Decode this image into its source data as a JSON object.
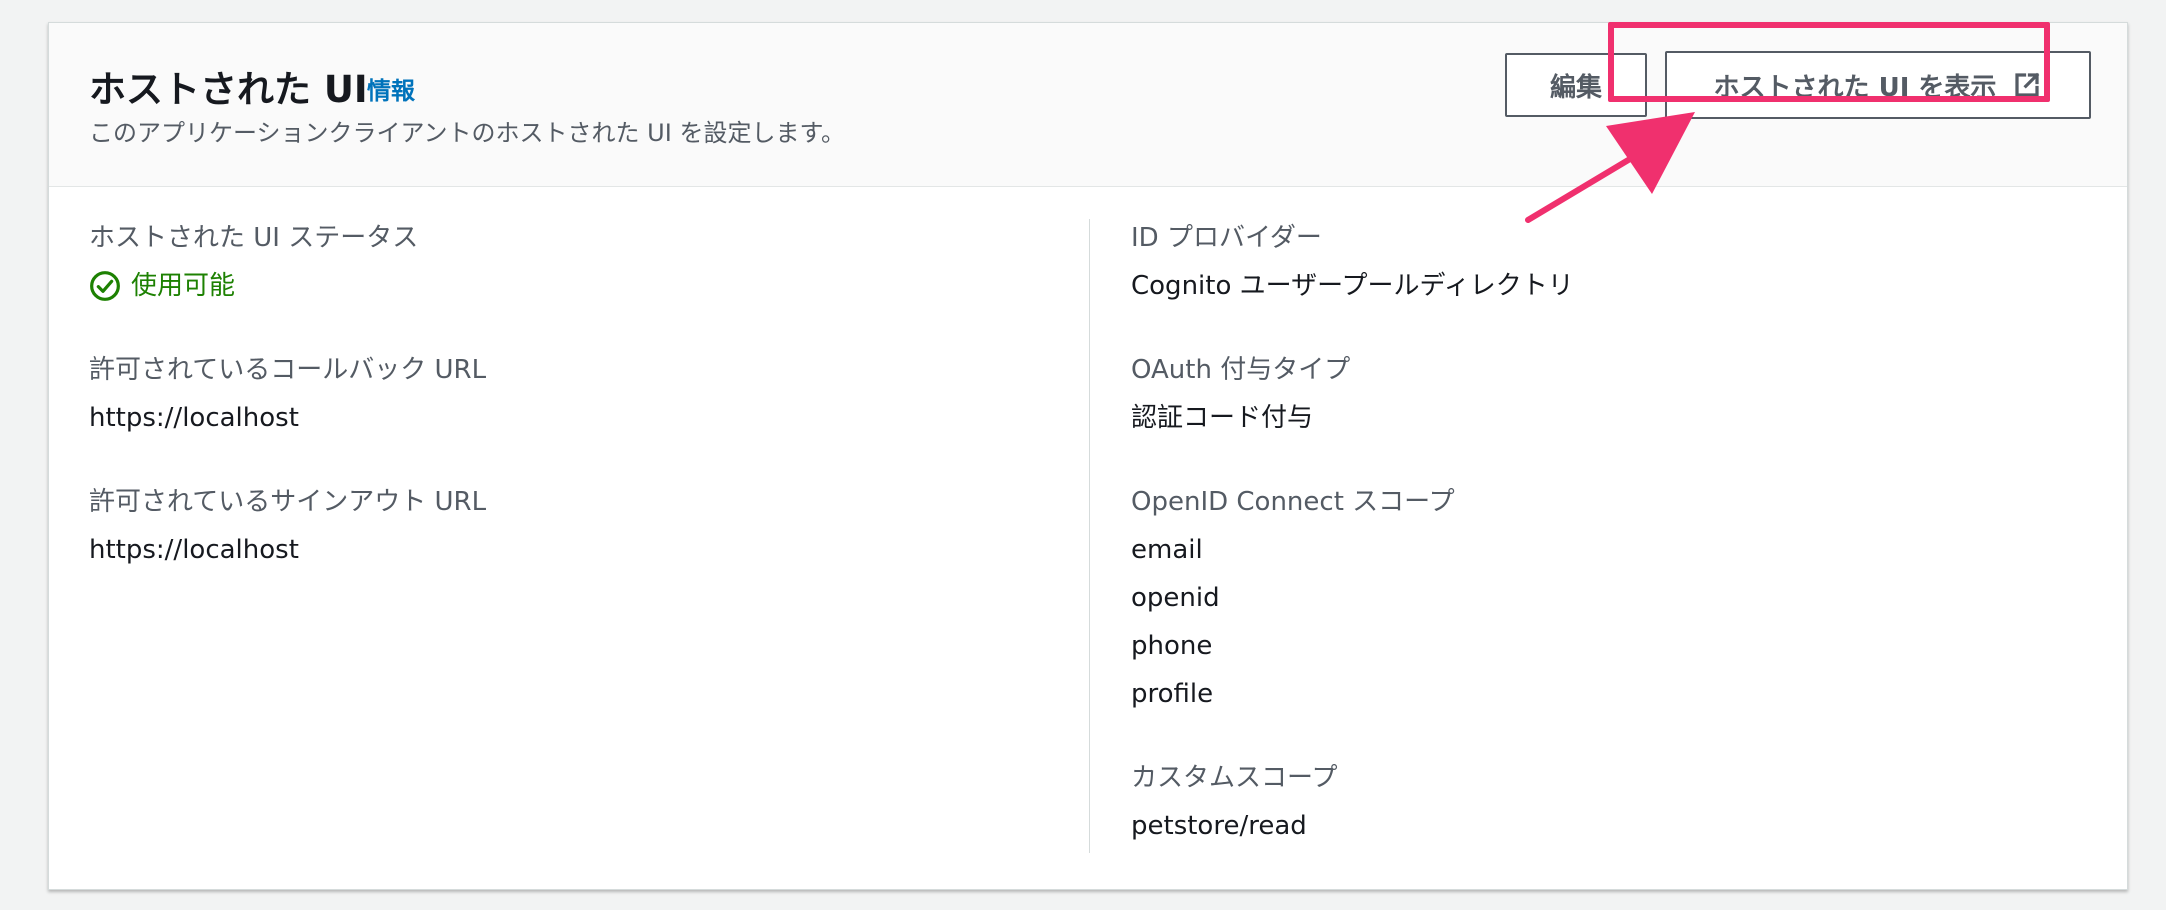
{
  "header": {
    "title": "ホストされた UI",
    "info_link": "情報",
    "description": "このアプリケーションクライアントのホストされた UI を設定します。",
    "edit_button": "編集",
    "view_button": "ホストされた UI を表示",
    "view_button_icon": "external-link-icon"
  },
  "left": {
    "status_label": "ホストされた UI ステータス",
    "status_value": "使用可能",
    "status_icon": "check-circle-icon",
    "callback_label": "許可されているコールバック URL",
    "callback_value": "https://localhost",
    "signout_label": "許可されているサインアウト URL",
    "signout_value": "https://localhost"
  },
  "right": {
    "idp_label": "ID プロバイダー",
    "idp_value": "Cognito ユーザープールディレクトリ",
    "oauth_label": "OAuth 付与タイプ",
    "oauth_value": "認証コード付与",
    "scopes_label": "OpenID Connect スコープ",
    "scopes": [
      "email",
      "openid",
      "phone",
      "profile"
    ],
    "custom_scope_label": "カスタムスコープ",
    "custom_scope_value": "petstore/read"
  },
  "colors": {
    "highlight": "#f0306e",
    "link": "#0073bb",
    "success": "#1d8102"
  }
}
